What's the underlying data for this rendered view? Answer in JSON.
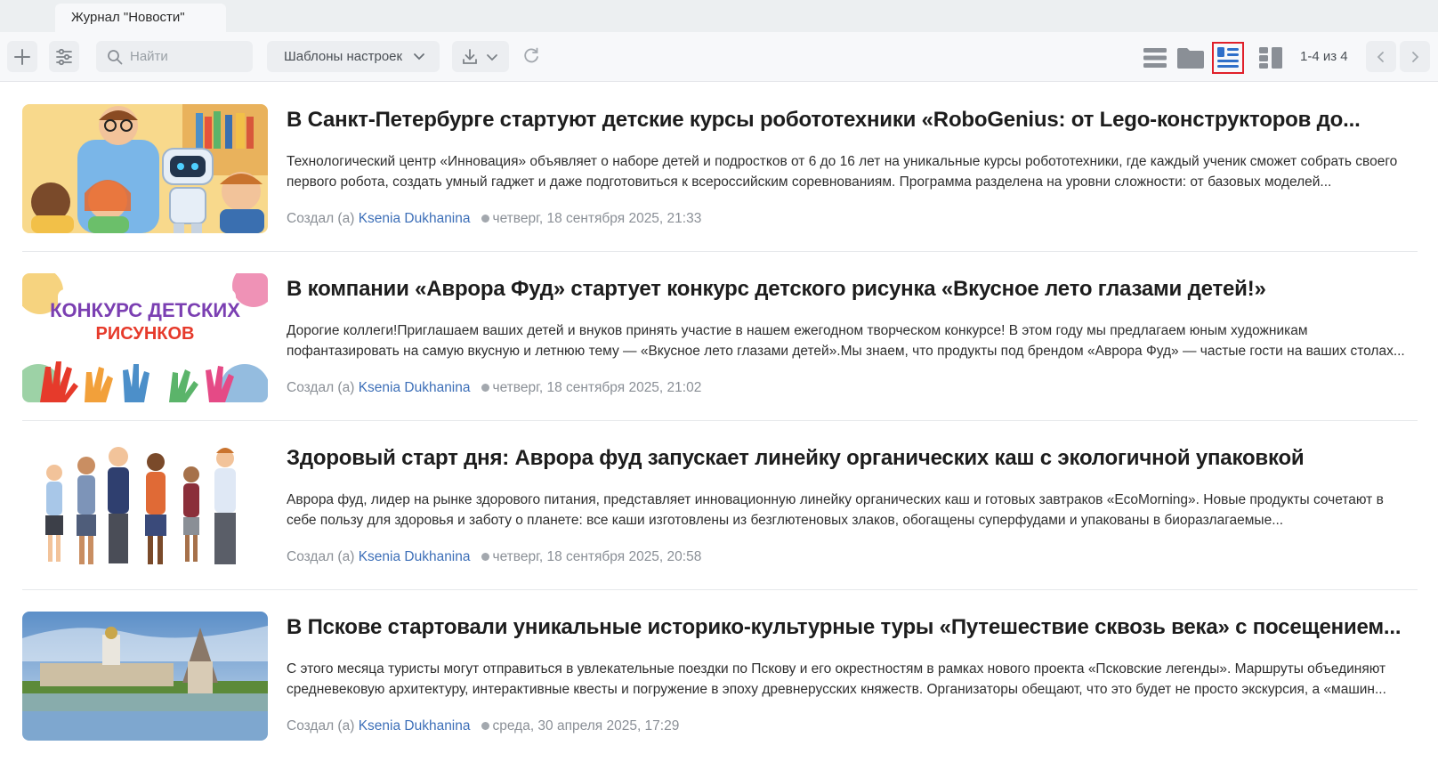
{
  "tab": {
    "title": "Журнал \"Новости\""
  },
  "toolbar": {
    "search_placeholder": "Найти",
    "templates_label": "Шаблоны настроек",
    "pager_label": "1-4 из 4"
  },
  "colors": {
    "active_outline": "#e0202a",
    "author_link": "#3d6fb8"
  },
  "articles": [
    {
      "title": "В Санкт-Петербурге стартуют детские курсы робототехники «RoboGenius: от Lego-конструкторов до...",
      "description": "Технологический центр «Инновация» объявляет о наборе детей и подростков от 6 до 16 лет на уникальные курсы робототехники, где каждый ученик сможет собрать своего первого робота, создать умный гаджет и даже подготовиться к всероссийским соревнованиям. Программа разделена на уровни сложности: от базовых моделей...",
      "created_prefix": "Создал (а)",
      "author": "Ksenia Dukhanina",
      "date": "четверг, 18 сентября 2025, 21:33",
      "image": "robotics-kids-illustration"
    },
    {
      "title": "В компании «Аврора Фуд» стартует конкурс детского рисунка «Вкусное лето глазами детей!»",
      "description": "Дорогие коллеги!Приглашаем ваших детей и внуков принять участие в нашем ежегодном творческом конкурсе! В этом году мы предлагаем юным художникам пофантазировать на самую вкусную и летнюю тему — «Вкусное лето глазами детей».Мы знаем, что продукты под брендом «Аврора Фуд» — частые гости на ваших столах...",
      "created_prefix": "Создал (а)",
      "author": "Ksenia Dukhanina",
      "date": "четверг, 18 сентября 2025, 21:02",
      "image": "drawing-contest-banner",
      "image_text_line1": "КОНКУРС ДЕТСКИХ",
      "image_text_line2": "РИСУНКОВ"
    },
    {
      "title": "Здоровый старт дня: Аврора фуд запускает линейку органических каш с экологичной упаковкой",
      "description": "Аврора фуд, лидер на рынке здорового питания, представляет инновационную линейку органических каш и готовых завтраков «EcoMorning». Новые продукты сочетают в себе пользу для здоровья и заботу о планете: все каши изготовлены из безглютеновых злаков, обогащены суперфудами и упакованы в биоразлагаемые...",
      "created_prefix": "Создал (а)",
      "author": "Ksenia Dukhanina",
      "date": "четверг, 18 сентября 2025, 20:58",
      "image": "schoolchildren-illustration"
    },
    {
      "title": "В Пскове стартовали уникальные историко-культурные туры «Путешествие сквозь века» с посещением...",
      "description": "С этого месяца туристы могут отправиться в увлекательные поездки по Пскову и его окрестностям в рамках нового проекта «Псковские легенды». Маршруты объединяют средневековую архитектуру, интерактивные квесты и погружение в эпоху древнерусских княжеств. Организаторы обещают, что это будет не просто экскурсия, а «машин...",
      "created_prefix": "Создал (а)",
      "author": "Ksenia Dukhanina",
      "date": "среда, 30 апреля 2025, 17:29",
      "image": "pskov-kremlin-photo"
    }
  ]
}
